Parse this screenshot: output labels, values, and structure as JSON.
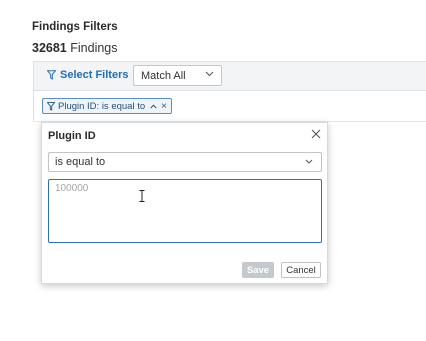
{
  "header": {
    "title": "Findings Filters",
    "count": "32681",
    "count_label": "Findings"
  },
  "filter_bar": {
    "select_filters_label": "Select Filters",
    "match_value": "Match All"
  },
  "chip": {
    "label": "Plugin ID: is equal to",
    "remove_symbol": "×"
  },
  "popover": {
    "title": "Plugin ID",
    "close_symbol": "×",
    "operator_value": "is equal to",
    "value_placeholder": "100000",
    "save_label": "Save",
    "cancel_label": "Cancel"
  },
  "colors": {
    "accent": "#1f6fb2",
    "input_focus": "#2f6fae",
    "disabled_button": "#c5c9cd"
  },
  "icons": [
    "filter-icon",
    "chevron-down-icon",
    "chevron-up-icon",
    "close-icon",
    "text-cursor-icon"
  ]
}
